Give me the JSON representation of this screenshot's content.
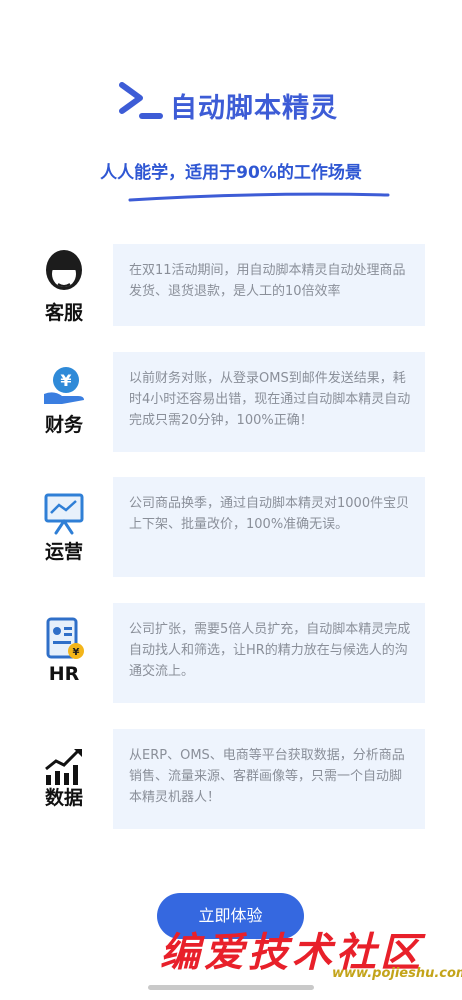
{
  "header": {
    "app_title": "自动脚本精灵",
    "logo_icon": "prompt-chevron-icon"
  },
  "slogan": "人人能学，适用于90%的工作场景",
  "features": [
    {
      "label": "客服",
      "icon": "customer-service-headset-icon",
      "description": "在双11活动期间，用自动脚本精灵自动处理商品发货、退货退款，是人工的10倍效率"
    },
    {
      "label": "财务",
      "icon": "finance-yen-hand-icon",
      "description": "以前财务对账，从登录OMS到邮件发送结果，耗时4小时还容易出错，现在通过自动脚本精灵自动完成只需20分钟，100%正确！"
    },
    {
      "label": "运营",
      "icon": "operations-presentation-board-icon",
      "description": "公司商品换季，通过自动脚本精灵对1000件宝贝上下架、批量改价，100%准确无误。"
    },
    {
      "label": "HR",
      "icon": "hr-resume-id-card-icon",
      "description": "公司扩张，需要5倍人员扩充，自动脚本精灵完成自动找人和筛选，让HR的精力放在与候选人的沟通交流上。"
    },
    {
      "label": "数据",
      "icon": "data-bar-chart-trend-icon",
      "description": "从ERP、OMS、电商等平台获取数据，分析商品销售、流量来源、客群画像等，只需一个自动脚本精灵机器人！"
    }
  ],
  "cta": {
    "label": "立即体验"
  },
  "watermark": {
    "title": "编爱技术社区",
    "url": "www.pojieshu.com"
  },
  "colors": {
    "brand_blue": "#3d5cd6",
    "card_bg": "#eef4fd",
    "card_text": "#8a8f99",
    "watermark_red": "#e8202a"
  }
}
